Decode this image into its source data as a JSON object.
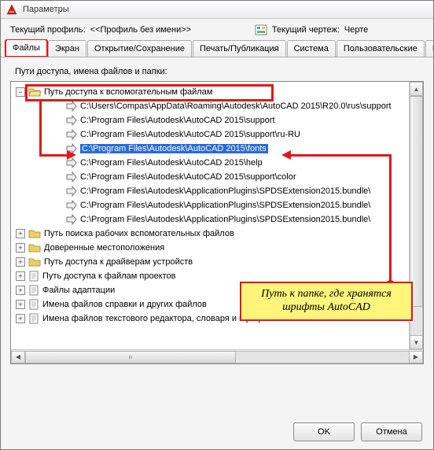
{
  "window": {
    "title": "Параметры"
  },
  "header": {
    "current_profile_label": "Текущий профиль:",
    "current_profile_value": "<<Профиль без имени>>",
    "current_drawing_label": "Текущий чертеж:",
    "current_drawing_value_partial": "Черте"
  },
  "tabs": {
    "items": [
      "Файлы",
      "Экран",
      "Открытие/Сохранение",
      "Печать/Публикация",
      "Система",
      "Пользовательские",
      "Построе"
    ],
    "active_index": 0
  },
  "panel": {
    "caption": "Пути доступа, имена файлов и папки:"
  },
  "tree": {
    "root": {
      "label": "Путь доступа к вспомогательным файлам"
    },
    "paths": [
      "C:\\Users\\Compas\\AppData\\Roaming\\Autodesk\\AutoCAD 2015\\R20.0\\rus\\support",
      "C:\\Program Files\\Autodesk\\AutoCAD 2015\\support",
      "C:\\Program Files\\Autodesk\\AutoCAD 2015\\support\\ru-RU",
      "C:\\Program Files\\Autodesk\\AutoCAD 2015\\fonts",
      "C:\\Program Files\\Autodesk\\AutoCAD 2015\\help",
      "C:\\Program Files\\Autodesk\\AutoCAD 2015\\support\\color",
      "C:\\Program Files\\Autodesk\\ApplicationPlugins\\SPDSExtension2015.bundle\\",
      "C:\\Program Files\\Autodesk\\ApplicationPlugins\\SPDSExtension2015.bundle\\",
      "C:\\Program Files\\Autodesk\\ApplicationPlugins\\SPDSExtension2015.bundle\\"
    ],
    "selected_index": 3,
    "siblings": [
      "Путь поиска рабочих вспомогательных файлов",
      "Доверенные местоположения",
      "Путь доступа к драйверам устройств",
      "Путь доступа к файлам проектов",
      "Файлы адаптации",
      "Имена файлов справки и других файлов",
      "Имена файлов текстового редактора, словаря и шрифтов"
    ]
  },
  "buttons": {
    "ok": "OK",
    "cancel": "Отмена"
  },
  "annotation": {
    "note_line1": "Путь к папке, где хранятся",
    "note_line2": "шрифты AutoCAD"
  }
}
